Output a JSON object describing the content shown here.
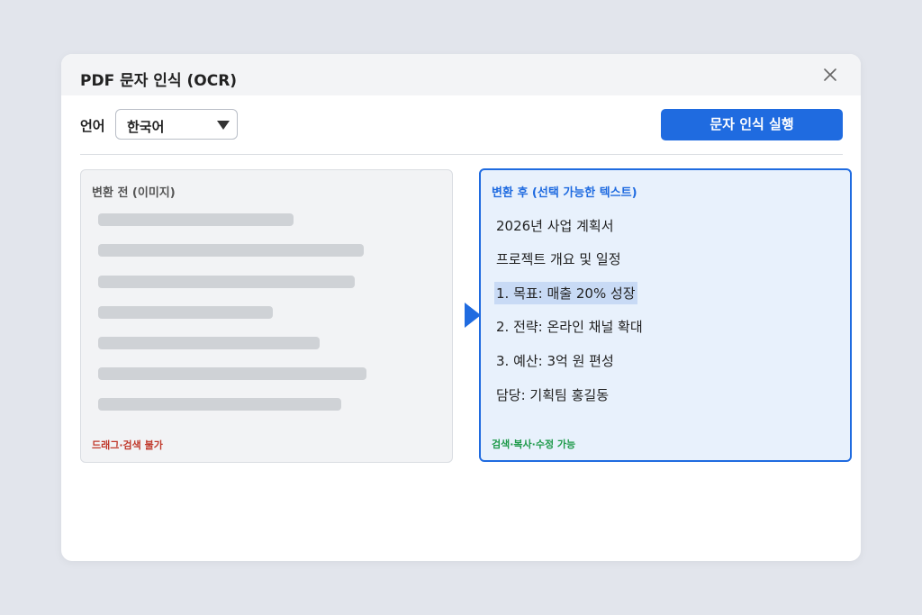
{
  "dialog": {
    "title": "PDF 문자 인식 (OCR)",
    "close_icon": "close-icon"
  },
  "toolbar": {
    "language_label": "언어",
    "language_value": "한국어",
    "run_label": "문자 인식 실행"
  },
  "before_panel": {
    "title": "변환 전 (이미지)",
    "footer": "드래그·검색 불가",
    "placeholder_lines": 7
  },
  "after_panel": {
    "title": "변환 후 (선택 가능한 텍스트)",
    "lines": [
      "2026년 사업 계획서",
      "프로젝트 개요 및 일정",
      "1. 목표: 매출 20% 성장",
      "2. 전략: 온라인 채널 확대",
      "3. 예산: 3억 원 편성",
      "담당: 기획팀 홍길동"
    ],
    "selected_line_index": 2,
    "footer": "검색·복사·수정 가능"
  },
  "colors": {
    "accent": "#1f6be0",
    "panel_after_bg": "#e8f1fc",
    "selection": "#c8daf5",
    "warning_text": "#c0392b",
    "success_text": "#1e9a4a"
  }
}
